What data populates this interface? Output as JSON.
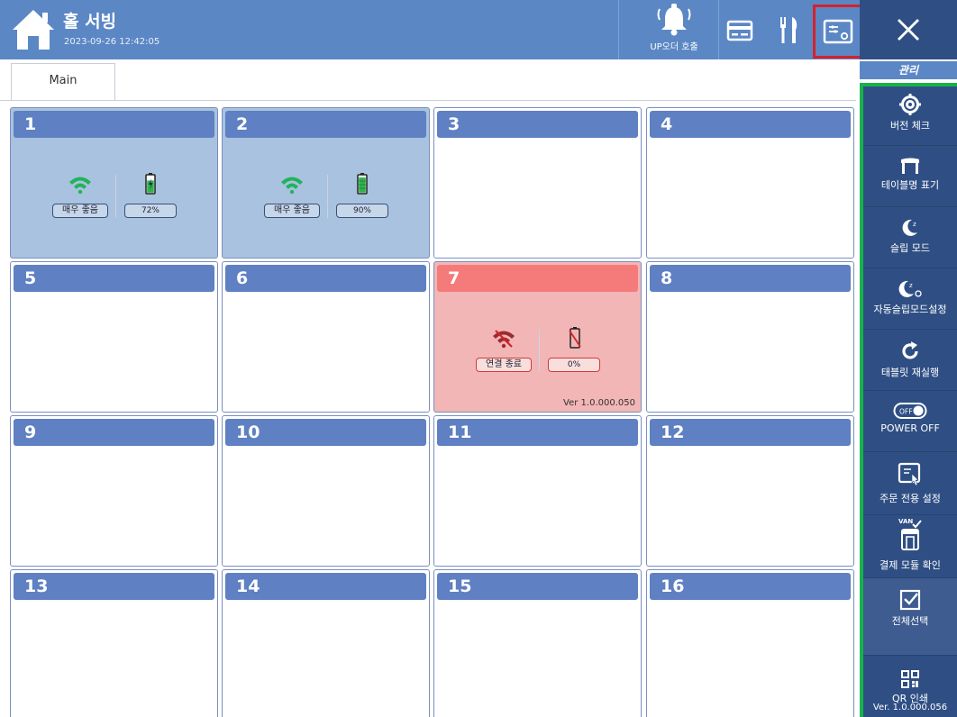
{
  "header": {
    "title": "홀 서빙",
    "datetime": "2023-09-26 12:42:05",
    "call_label": "UP오더 호출"
  },
  "side": {
    "title": "관리",
    "items": [
      {
        "label": "버전 체크",
        "icon": "gear-icon"
      },
      {
        "label": "테이블명 표기",
        "icon": "table-icon"
      },
      {
        "label": "슬립 모드",
        "icon": "moon-icon"
      },
      {
        "label": "자동슬립모드설정",
        "icon": "moon-timer-icon"
      },
      {
        "label": "태블릿 재실행",
        "icon": "refresh-icon"
      },
      {
        "label": "POWER OFF",
        "icon": "power-toggle-icon"
      },
      {
        "label": "주문 전용 설정",
        "icon": "touch-screen-icon"
      },
      {
        "label": "결제 모듈 확인",
        "icon": "payment-module-icon"
      },
      {
        "label": "전체선택",
        "icon": "checkbox-icon"
      },
      {
        "label": "QR 인쇄",
        "icon": "qr-icon"
      }
    ],
    "toggle_text": "OFF",
    "van_text": "VAN",
    "version": "Ver. 1.0.000.056"
  },
  "tabs": [
    {
      "label": "Main"
    }
  ],
  "tables": [
    {
      "number": "1",
      "state": "connected",
      "signal": "매우 좋음",
      "battery": "72%",
      "battery_level": 0.72,
      "charging": true
    },
    {
      "number": "2",
      "state": "connected",
      "signal": "매우 좋음",
      "battery": "90%",
      "battery_level": 0.9,
      "charging": false
    },
    {
      "number": "3",
      "state": "empty"
    },
    {
      "number": "4",
      "state": "empty"
    },
    {
      "number": "5",
      "state": "empty"
    },
    {
      "number": "6",
      "state": "empty"
    },
    {
      "number": "7",
      "state": "disconnected",
      "signal": "연결 종료",
      "battery": "0%",
      "battery_level": 0,
      "version": "Ver 1.0.000.050"
    },
    {
      "number": "8",
      "state": "empty"
    },
    {
      "number": "9",
      "state": "empty"
    },
    {
      "number": "10",
      "state": "empty"
    },
    {
      "number": "11",
      "state": "empty"
    },
    {
      "number": "12",
      "state": "empty"
    },
    {
      "number": "13",
      "state": "empty"
    },
    {
      "number": "14",
      "state": "empty"
    },
    {
      "number": "15",
      "state": "empty"
    },
    {
      "number": "16",
      "state": "empty"
    }
  ],
  "colors": {
    "header": "#5b87c5",
    "panel": "#2f4f84",
    "panel_highlight": "#17b24a",
    "table_header": "#5f80c2",
    "connected_bg": "#a9c2df",
    "disconnected_bg": "#f2b6b6",
    "disconnected_header": "#f57a7a",
    "signal_good": "#22b35a",
    "battery_green": "#2fb34a",
    "alert_red": "#d4222d"
  }
}
